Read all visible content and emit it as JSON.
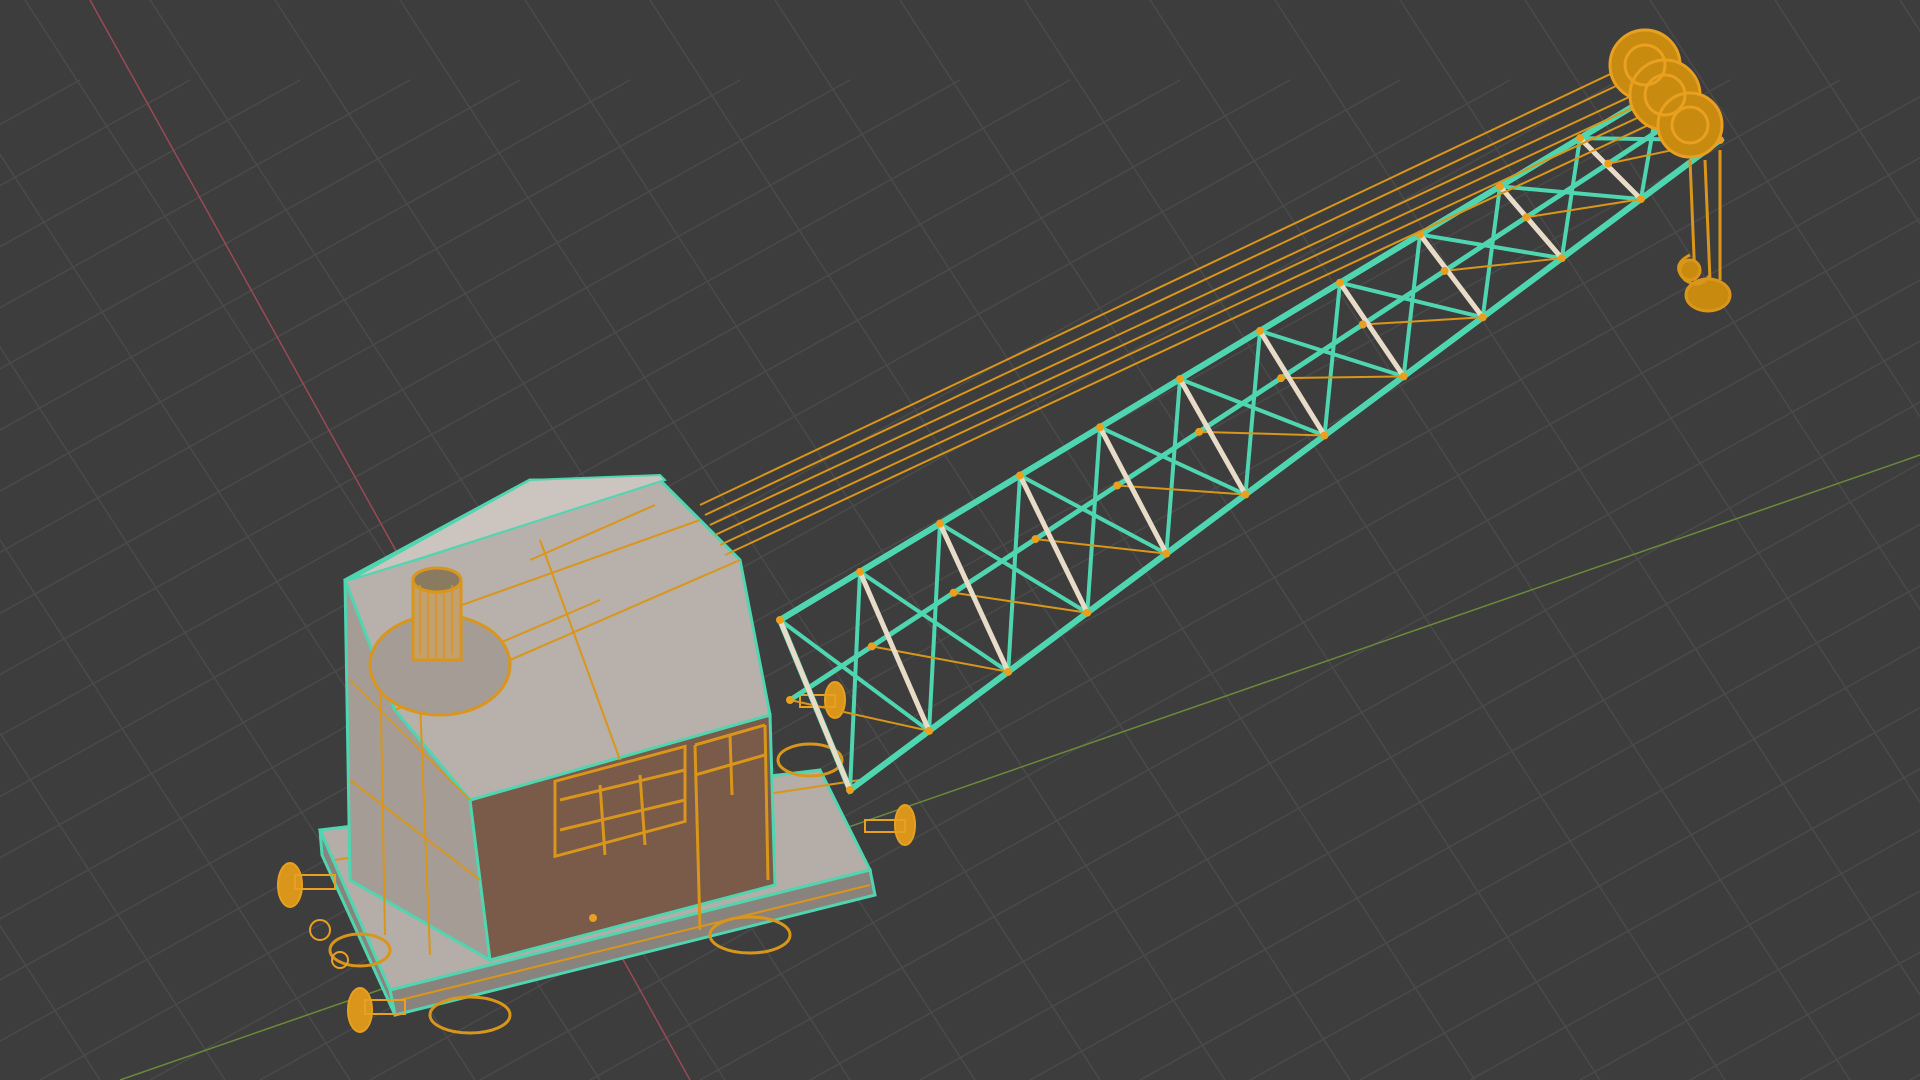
{
  "app": {
    "name": "3D viewport",
    "mode": "edit-mode-wireframe-overlay"
  },
  "scene": {
    "object": "railway-steam-crane",
    "parts": [
      "cab",
      "chimney",
      "boom-lattice",
      "boom-cables",
      "pulley-head",
      "hook-block",
      "flatbed-chassis",
      "buffers",
      "wheels"
    ]
  },
  "colors": {
    "background": "#3d3d3d",
    "grid": "#4a4a4a",
    "x_axis": "#9a4a55",
    "y_axis": "#6a8a3a",
    "selected_vertex": "#e8a020",
    "selected_edge": "#d9961a",
    "active_edge": "#4fd6b0",
    "face": "#9a9088",
    "face_dark": "#7a6050"
  },
  "icons": {
    "object_origin": "origin-dot-icon"
  }
}
